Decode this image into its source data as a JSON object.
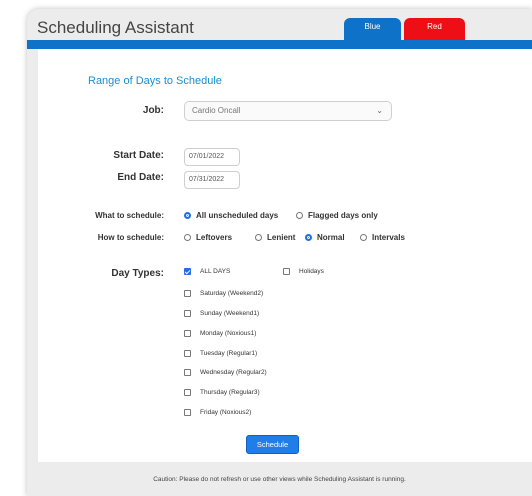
{
  "header": {
    "title": "Scheduling Assistant"
  },
  "tabs": [
    {
      "label": "Blue",
      "color": "#0e72c8"
    },
    {
      "label": "Red",
      "color": "#ee0e16"
    }
  ],
  "section": {
    "title": "Range of Days to Schedule"
  },
  "job": {
    "label": "Job:",
    "value": "Cardio Oncall"
  },
  "dates": {
    "start_label": "Start Date:",
    "start_value": "07/01/2022",
    "end_label": "End Date:",
    "end_value": "07/31/2022"
  },
  "what": {
    "label": "What to schedule:",
    "options": [
      {
        "label": "All unscheduled days",
        "selected": true
      },
      {
        "label": "Flagged days only",
        "selected": false
      }
    ]
  },
  "how": {
    "label": "How to schedule:",
    "options": [
      {
        "label": "Leftovers",
        "selected": false
      },
      {
        "label": "Lenient",
        "selected": false
      },
      {
        "label": "Normal",
        "selected": true
      },
      {
        "label": "Intervals",
        "selected": false
      }
    ]
  },
  "daytypes": {
    "label": "Day Types:",
    "all": {
      "label": "ALL DAYS",
      "checked": true
    },
    "holidays": {
      "label": "Holidays",
      "checked": false
    },
    "items": [
      {
        "label": "Saturday (Weekend2)",
        "checked": false
      },
      {
        "label": "Sunday (Weekend1)",
        "checked": false
      },
      {
        "label": "Monday (Noxious1)",
        "checked": false
      },
      {
        "label": "Tuesday (Regular1)",
        "checked": false
      },
      {
        "label": "Wednesday (Regular2)",
        "checked": false
      },
      {
        "label": "Thursday (Regular3)",
        "checked": false
      },
      {
        "label": "Friday (Noxious2)",
        "checked": false
      }
    ]
  },
  "actions": {
    "schedule_label": "Schedule"
  },
  "footer": {
    "caution": "Caution: Please do not refresh or use other views while Scheduling Assistant is running."
  },
  "colors": {
    "accent": "#0e72c8",
    "button": "#1f7ee8",
    "section_title": "#1a8fd1"
  }
}
